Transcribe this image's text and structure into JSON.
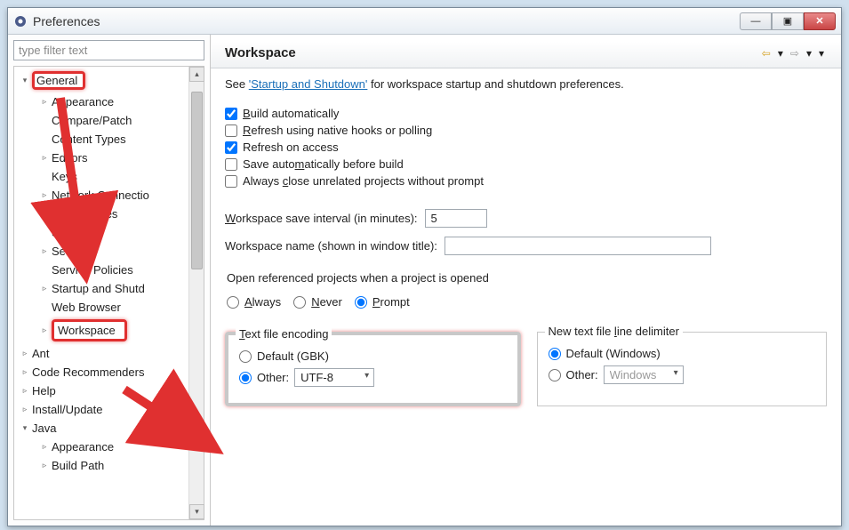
{
  "window": {
    "title": "Preferences"
  },
  "winbtns": {
    "min": "—",
    "max": "▣",
    "close": "✕"
  },
  "filter_placeholder": "type filter text",
  "tree": {
    "n0": "General",
    "n1": "Appearance",
    "n2": "Compare/Patch",
    "n3": "Content Types",
    "n4": "Editors",
    "n5": "Keys",
    "n6": "Network Connectio",
    "n7": "Perspectives",
    "n8": "Search",
    "n9": "Security",
    "n10": "Service Policies",
    "n11": "Startup and Shutd",
    "n12": "Web Browser",
    "n13": "Workspace",
    "n14": "Ant",
    "n15": "Code Recommenders",
    "n16": "Help",
    "n17": "Install/Update",
    "n18": "Java",
    "n19": "Appearance",
    "n20": "Build Path"
  },
  "header": {
    "title": "Workspace"
  },
  "desc": {
    "prefix": "See ",
    "link": "'Startup and Shutdown'",
    "suffix": " for workspace startup and shutdown preferences."
  },
  "checks": {
    "build": "Build automatically",
    "refresh_hooks": "Refresh using native hooks or polling",
    "refresh_access": "Refresh on access",
    "save_before": "Save automatically before build",
    "close_unrelated": "Always close unrelated projects without prompt"
  },
  "interval": {
    "label": "Workspace save interval (in minutes):",
    "value": "5"
  },
  "wsname": {
    "label": "Workspace name (shown in window title):",
    "value": ""
  },
  "refproj": {
    "caption": "Open referenced projects when a project is opened",
    "always": "Always",
    "never": "Never",
    "prompt": "Prompt"
  },
  "encoding": {
    "legend": "Text file encoding",
    "default_label": "Default (GBK)",
    "other_label": "Other:",
    "other_value": "UTF-8"
  },
  "delimiter": {
    "legend": "New text file line delimiter",
    "default_label": "Default (Windows)",
    "other_label": "Other:",
    "other_value": "Windows"
  }
}
